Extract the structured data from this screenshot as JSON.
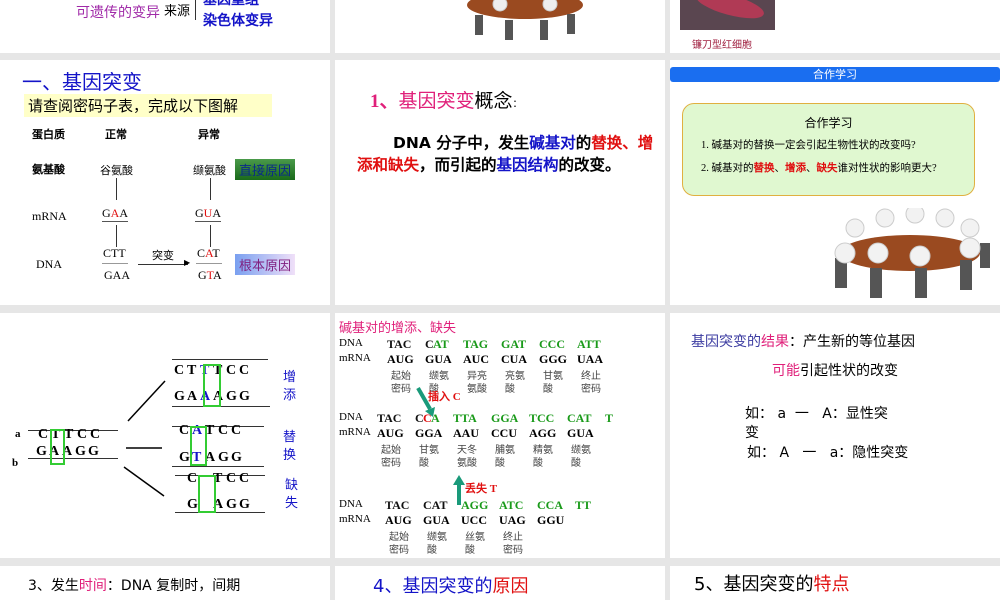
{
  "slide_top_left": {
    "heritable": "可遗传的变异",
    "source": "来源",
    "gene_recomb": "基因重组",
    "chrom": "染色体变异"
  },
  "slide_top_right": {
    "caption": "镰刀型红细胞"
  },
  "slide_gene_mutation": {
    "title": "一、基因突变",
    "instruction": "请查阅密码子表，完成以下图解",
    "col_protein": "蛋白质",
    "col_normal": "正常",
    "col_abnormal": "异常",
    "row_aa": "氨基酸",
    "aa_normal": "谷氨酸",
    "aa_abnormal": "缬氨酸",
    "direct_cause": "直接原因",
    "row_mrna": "mRNA",
    "mrna_normal": [
      "G",
      "A",
      "A"
    ],
    "mrna_abnormal": [
      "G",
      "U",
      "A"
    ],
    "row_dna": "DNA",
    "dna_normal_top": "CTT",
    "dna_normal_bottom": "GAA",
    "mutation": "突变",
    "dna_abn_top": [
      "C",
      "A",
      "T"
    ],
    "dna_abn_bottom": [
      "G",
      "T",
      "A"
    ],
    "root_cause": "根本原因"
  },
  "slide_concept": {
    "title_num": "1、",
    "title_key": "基因突变",
    "title_rest": "概念",
    "colon": "：",
    "p1": "DNA 分子中，发生",
    "p2": "碱基对",
    "p3": "的",
    "p4": "替换、增添和缺失",
    "p5": "，而引起的",
    "p6": "基因结构",
    "p7": "的改变。"
  },
  "slide_coop": {
    "banner": "合作学习",
    "box_title": "合作学习",
    "q1": "1. 碱基对的替换一定会引起生物性状的改变吗?",
    "q2_pre": "2. 碱基对的",
    "q2_a": "替换",
    "q2_sep1": "、",
    "q2_b": "增添",
    "q2_sep2": "、",
    "q2_c": "缺失",
    "q2_post": "谁对性状的影响更大?"
  },
  "slide_diagram": {
    "strand_a": "a",
    "strand_b": "b",
    "orig_top": [
      "C",
      "T",
      "T",
      "C",
      "C"
    ],
    "orig_bottom": [
      "G",
      "A",
      "A",
      "G",
      "G"
    ],
    "ins_top": [
      "C",
      "T",
      "T",
      "T",
      "C",
      "C"
    ],
    "ins_bottom": [
      "G",
      "A",
      "A",
      "A",
      "G",
      "G"
    ],
    "ins_label": "增添",
    "sub_top": [
      "C",
      "A",
      "T",
      "C",
      "C"
    ],
    "sub_bottom": [
      "G",
      "T",
      "A",
      "G",
      "G"
    ],
    "sub_label": "替换",
    "del_top": [
      "C",
      "",
      "T",
      "C",
      "C"
    ],
    "del_bottom": [
      "G",
      "",
      "A",
      "G",
      "G"
    ],
    "del_label": "缺失"
  },
  "slide_indel": {
    "title": "碱基对的增添、缺失",
    "r1_dna_label": "DNA",
    "r1_dna": [
      "TAC",
      "C",
      "AT",
      "TAG",
      "GAT",
      "CCC",
      "ATT"
    ],
    "r1_mrna_label": "mRNA",
    "r1_mrna": [
      "AUG",
      "GUA",
      "AUC",
      "CUA",
      "GGG",
      "UAA"
    ],
    "r1_aa": [
      [
        "起始",
        "密码"
      ],
      [
        "缬氨",
        "酸"
      ],
      [
        "异亮",
        "氨酸"
      ],
      [
        "亮氨",
        "酸"
      ],
      [
        "甘氨",
        "酸"
      ],
      [
        "终止",
        "密码"
      ]
    ],
    "insert": "插入 C",
    "r2_dna_label": "DNA",
    "r2_dna": [
      "TAC",
      "C",
      "C",
      "A",
      "TTA",
      "GGA",
      "TCC",
      "CAT",
      "T"
    ],
    "r2_mrna_label": "mRNA",
    "r2_mrna": [
      "AUG",
      "GGA",
      "AAU",
      "CCU",
      "AGG",
      "GUA"
    ],
    "r2_aa": [
      [
        "起始",
        "密码"
      ],
      [
        "甘氨",
        "酸"
      ],
      [
        "天冬",
        "氨酸"
      ],
      [
        "脯氨",
        "酸"
      ],
      [
        "精氨",
        "酸"
      ],
      [
        "缬氨",
        "酸"
      ]
    ],
    "delete": "丢失 T",
    "r3_dna_label": "DNA",
    "r3_dna": [
      "TAC",
      "CAT",
      "AGG",
      "ATC",
      "CCA",
      "TT"
    ],
    "r3_mrna_label": "mRNA",
    "r3_mrna": [
      "AUG",
      "GUA",
      "UCC",
      "UAG",
      "GGU"
    ],
    "r3_aa": [
      [
        "起始",
        "密码"
      ],
      [
        "缬氨",
        "酸"
      ],
      [
        "丝氨",
        "酸"
      ],
      [
        "终止",
        "密码"
      ]
    ]
  },
  "slide_result": {
    "l1a": "基因突变的",
    "l1b": "结果",
    "l1c": "：产生新的等位基因",
    "l2a": "可能",
    "l2b": "引起性状的改变",
    "ex1": "如： a  一   A：显性突",
    "ex1b": "变",
    "ex2": "如： A   一   a：隐性突变"
  },
  "slide_time": {
    "pre": "3、发生",
    "key": "时间",
    "post": "：DNA 复制时，间期"
  },
  "slide_cause": {
    "pre": "4、基因突变的",
    "key": "原因"
  },
  "slide_feature": {
    "pre": "5、基因突变的",
    "key": "特点"
  }
}
